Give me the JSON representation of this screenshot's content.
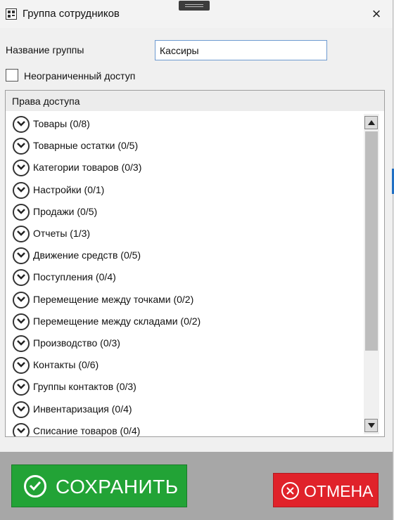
{
  "window": {
    "title": "Группа сотрудников",
    "close_icon": "×"
  },
  "form": {
    "name_label": "Название группы",
    "name_value": "Кассиры",
    "unlimited_label": "Неограниченный доступ",
    "unlimited_checked": false
  },
  "permissions": {
    "header": "Права доступа",
    "items": [
      {
        "label": "Товары (0/8)"
      },
      {
        "label": "Товарные остатки (0/5)"
      },
      {
        "label": "Категории товаров (0/3)"
      },
      {
        "label": "Настройки (0/1)"
      },
      {
        "label": "Продажи (0/5)"
      },
      {
        "label": "Отчеты (1/3)"
      },
      {
        "label": "Движение средств (0/5)"
      },
      {
        "label": "Поступления (0/4)"
      },
      {
        "label": "Перемещение между точками (0/2)"
      },
      {
        "label": "Перемещение между складами (0/2)"
      },
      {
        "label": "Производство (0/3)"
      },
      {
        "label": "Контакты (0/6)"
      },
      {
        "label": "Группы контактов (0/3)"
      },
      {
        "label": "Инвентаризация (0/4)"
      },
      {
        "label": "Списание товаров (0/4)"
      }
    ]
  },
  "footer": {
    "save_label": "СОХРАНИТЬ",
    "cancel_label": "ОТМЕНА"
  },
  "colors": {
    "save": "#22a336",
    "cancel": "#e0222a",
    "input_border": "#6e9ad0"
  }
}
